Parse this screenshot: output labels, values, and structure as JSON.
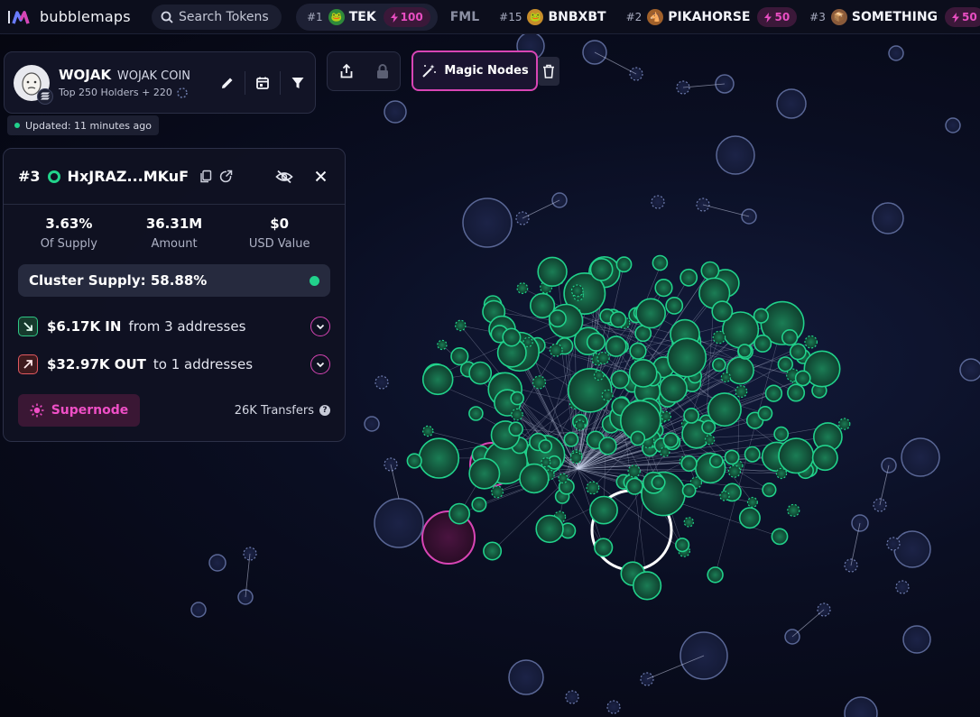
{
  "brand": {
    "name": "bubblemaps"
  },
  "search": {
    "placeholder": "Search Tokens"
  },
  "trending": [
    {
      "rank": "#1",
      "name": "TEK",
      "boost": "100",
      "avatar": "frog"
    },
    {
      "faded": "FML"
    },
    {
      "rank": "#15",
      "name": "BNBXBT",
      "avatar": "pepe"
    },
    {
      "rank": "#2",
      "name": "PIKAHORSE",
      "boost": "50",
      "avatar": "horse"
    },
    {
      "rank": "#3",
      "name": "SOMETHING",
      "boost": "50",
      "avatar": "box"
    }
  ],
  "token": {
    "symbol": "WOJAK",
    "name": "WOJAK COIN",
    "holders_text": "Top 250 Holders + 220",
    "updated": "Updated: 11 minutes ago",
    "chain_icon": "solana-icon"
  },
  "toolbar": {
    "magic_label": "Magic Nodes"
  },
  "detail": {
    "rank": "#3",
    "address": "HxJRAZ...MKuF",
    "stats": [
      {
        "value": "3.63%",
        "label": "Of Supply"
      },
      {
        "value": "36.31M",
        "label": "Amount"
      },
      {
        "value": "$0",
        "label": "USD Value"
      }
    ],
    "cluster_supply": "Cluster Supply: 58.88%",
    "inflow": {
      "amount": "$6.17K IN",
      "text": "from 3 addresses"
    },
    "outflow": {
      "amount": "$32.97K OUT",
      "text": "to 1 addresses"
    },
    "supernode_label": "Supernode",
    "transfers": "26K Transfers"
  },
  "colors": {
    "accent": "#d845b5",
    "cluster_green": "#21d18b",
    "isolated_node": "#2a3458"
  }
}
